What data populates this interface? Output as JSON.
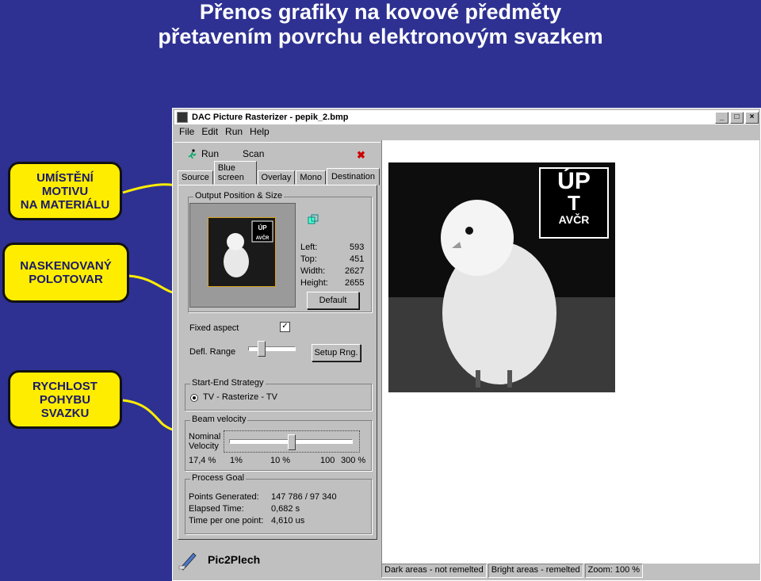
{
  "slide": {
    "title_line1": "Přenos grafiky na kovové předměty",
    "title_line2": "přetavením povrchu elektronovým svazkem"
  },
  "callouts": [
    {
      "line1": "UMÍSTĚNÍ",
      "line2": "MOTIVU",
      "line3": "NA MATERIÁLU"
    },
    {
      "line1": "NASKENOVANÝ",
      "line2": "POLOTOVAR",
      "line3": ""
    },
    {
      "line1": "RYCHLOST",
      "line2": "POHYBU",
      "line3": "SVAZKU"
    }
  ],
  "window": {
    "title": "DAC Picture Rasterizer - pepik_2.bmp",
    "menu": [
      "File",
      "Edit",
      "Run",
      "Help"
    ],
    "toolbar": {
      "run_label": "Run",
      "scan_label": "Scan",
      "stop_glyph": "✖"
    },
    "tabs": [
      "Source",
      "Blue screen",
      "Overlay",
      "Mono",
      "Destination"
    ],
    "active_tab": "Destination",
    "output": {
      "group_label": "Output Position & Size",
      "left_label": "Left:",
      "left_value": "593",
      "top_label": "Top:",
      "top_value": "451",
      "width_label": "Width:",
      "width_value": "2627",
      "height_label": "Height:",
      "height_value": "2655",
      "default_button": "Default"
    },
    "fixed_aspect": {
      "label": "Fixed aspect",
      "checked": true
    },
    "defl": {
      "label": "Defl. Range",
      "button": "Setup Rng."
    },
    "strategy": {
      "group_label": "Start-End Strategy",
      "option": "TV - Rasterize - TV"
    },
    "beam": {
      "group_label": "Beam velocity",
      "nominal_label_1": "Nominal",
      "nominal_label_2": "Velocity",
      "value": "17,4 %",
      "ticks": [
        "1%",
        "10 %",
        "100",
        "300 %"
      ]
    },
    "process": {
      "group_label": "Process Goal",
      "points_label": "Points Generated:",
      "points_value": "147 786 / 97 340",
      "elapsed_label": "Elapsed Time:",
      "elapsed_value": "0,682 s",
      "tpp_label": "Time per one point:",
      "tpp_value": "4,610 us"
    },
    "footer_brand": "Pic2Plech",
    "status": [
      "Dark areas - not remelted",
      "Bright areas - remelted",
      "Zoom: 100 %"
    ],
    "logo_text": {
      "top": "ÚP",
      "mid": "T",
      "bottom": "AVČR"
    }
  },
  "colors": {
    "background": "#2e3192",
    "callout": "#ffed00",
    "arrow": "#ffed00"
  }
}
